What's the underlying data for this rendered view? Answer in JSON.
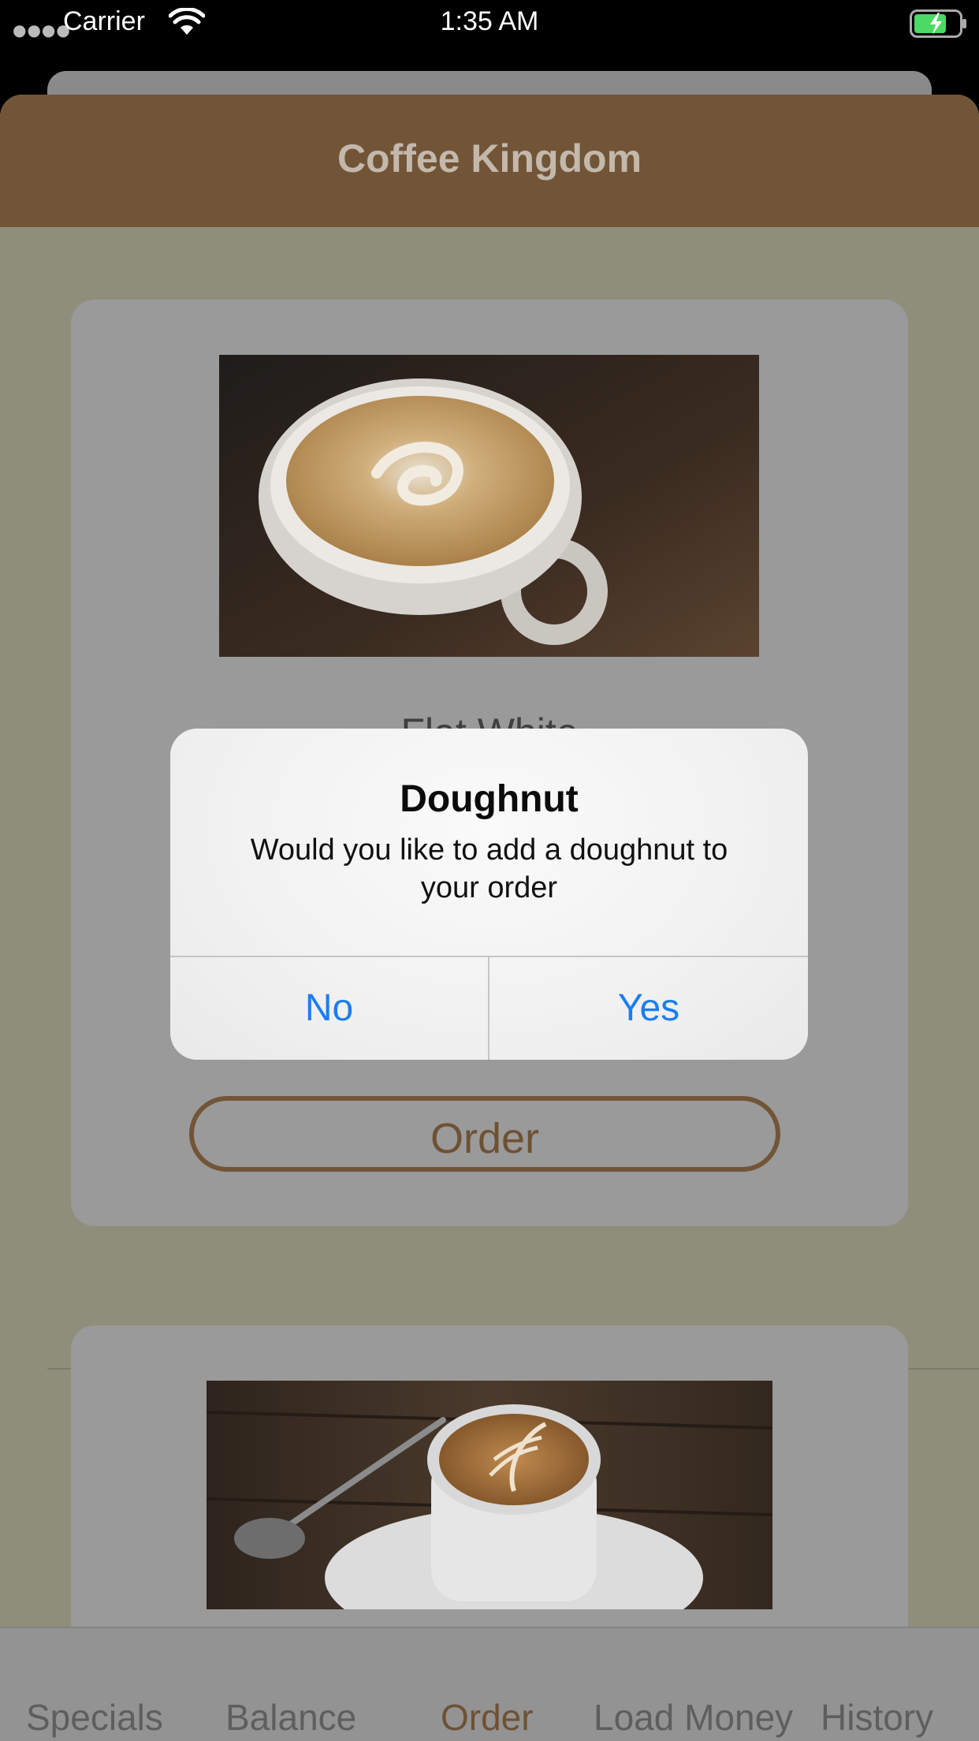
{
  "status_bar": {
    "carrier": "Carrier",
    "time": "1:35 AM"
  },
  "header": {
    "title": "Coffee Kingdom"
  },
  "menu": {
    "items": [
      {
        "name": "Flat White",
        "order_label": "Order"
      }
    ]
  },
  "alert": {
    "title": "Doughnut",
    "message": "Would you like to add a doughnut to your order",
    "no_label": "No",
    "yes_label": "Yes"
  },
  "tab_bar": {
    "tabs": [
      {
        "label": "Specials"
      },
      {
        "label": "Balance"
      },
      {
        "label": "Order"
      },
      {
        "label": "Load Money"
      },
      {
        "label": "History"
      }
    ],
    "active": "Order"
  },
  "colors": {
    "brand_brown": "#725537",
    "alert_button_blue": "#1a7ef0",
    "battery_green": "#4cd964"
  }
}
